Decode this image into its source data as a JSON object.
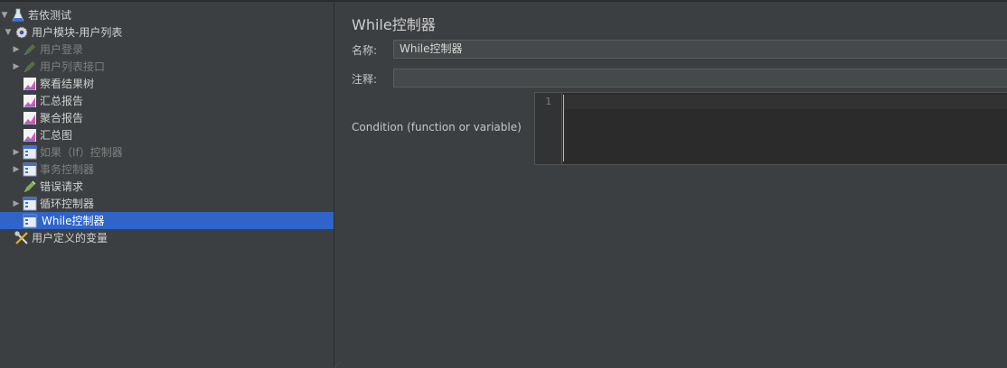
{
  "tree": {
    "items": [
      {
        "label": "若依测试",
        "icon": "flask-icon",
        "arrow": "▼",
        "dim": false
      },
      {
        "label": "用户模块-用户列表",
        "icon": "gear-icon",
        "arrow": "▼",
        "dim": false
      },
      {
        "label": "用户登录",
        "icon": "sampler-pen-icon",
        "arrow": "▶",
        "dim": true
      },
      {
        "label": "用户列表接口",
        "icon": "sampler-pen-icon",
        "arrow": "▶",
        "dim": true
      },
      {
        "label": "察看结果树",
        "icon": "listener-chart-icon",
        "arrow": "",
        "dim": false
      },
      {
        "label": "汇总报告",
        "icon": "listener-chart-icon",
        "arrow": "",
        "dim": false
      },
      {
        "label": "聚合报告",
        "icon": "listener-chart-icon",
        "arrow": "",
        "dim": false
      },
      {
        "label": "汇总图",
        "icon": "listener-chart-icon",
        "arrow": "",
        "dim": false
      },
      {
        "label": "如果（If）控制器",
        "icon": "controller-icon",
        "arrow": "▶",
        "dim": true
      },
      {
        "label": "事务控制器",
        "icon": "controller-icon",
        "arrow": "▶",
        "dim": true
      },
      {
        "label": "错误请求",
        "icon": "sampler-pen-icon",
        "arrow": "",
        "dim": false
      },
      {
        "label": "循环控制器",
        "icon": "controller-icon",
        "arrow": "▶",
        "dim": false
      },
      {
        "label": "While控制器",
        "icon": "controller-icon",
        "arrow": "",
        "dim": false,
        "selected": true
      },
      {
        "label": "用户定义的变量",
        "icon": "tools-icon",
        "arrow": "",
        "dim": false
      }
    ]
  },
  "panel": {
    "title": "While控制器",
    "name_label": "名称:",
    "name_value": "While控制器",
    "comment_label": "注释:",
    "comment_value": "",
    "condition_label": "Condition (function or variable)",
    "editor_line_number": "1",
    "editor_value": ""
  },
  "colors": {
    "selection": "#2f65ca",
    "background": "#3c3f41",
    "editor_bg": "#2b2b2b"
  }
}
